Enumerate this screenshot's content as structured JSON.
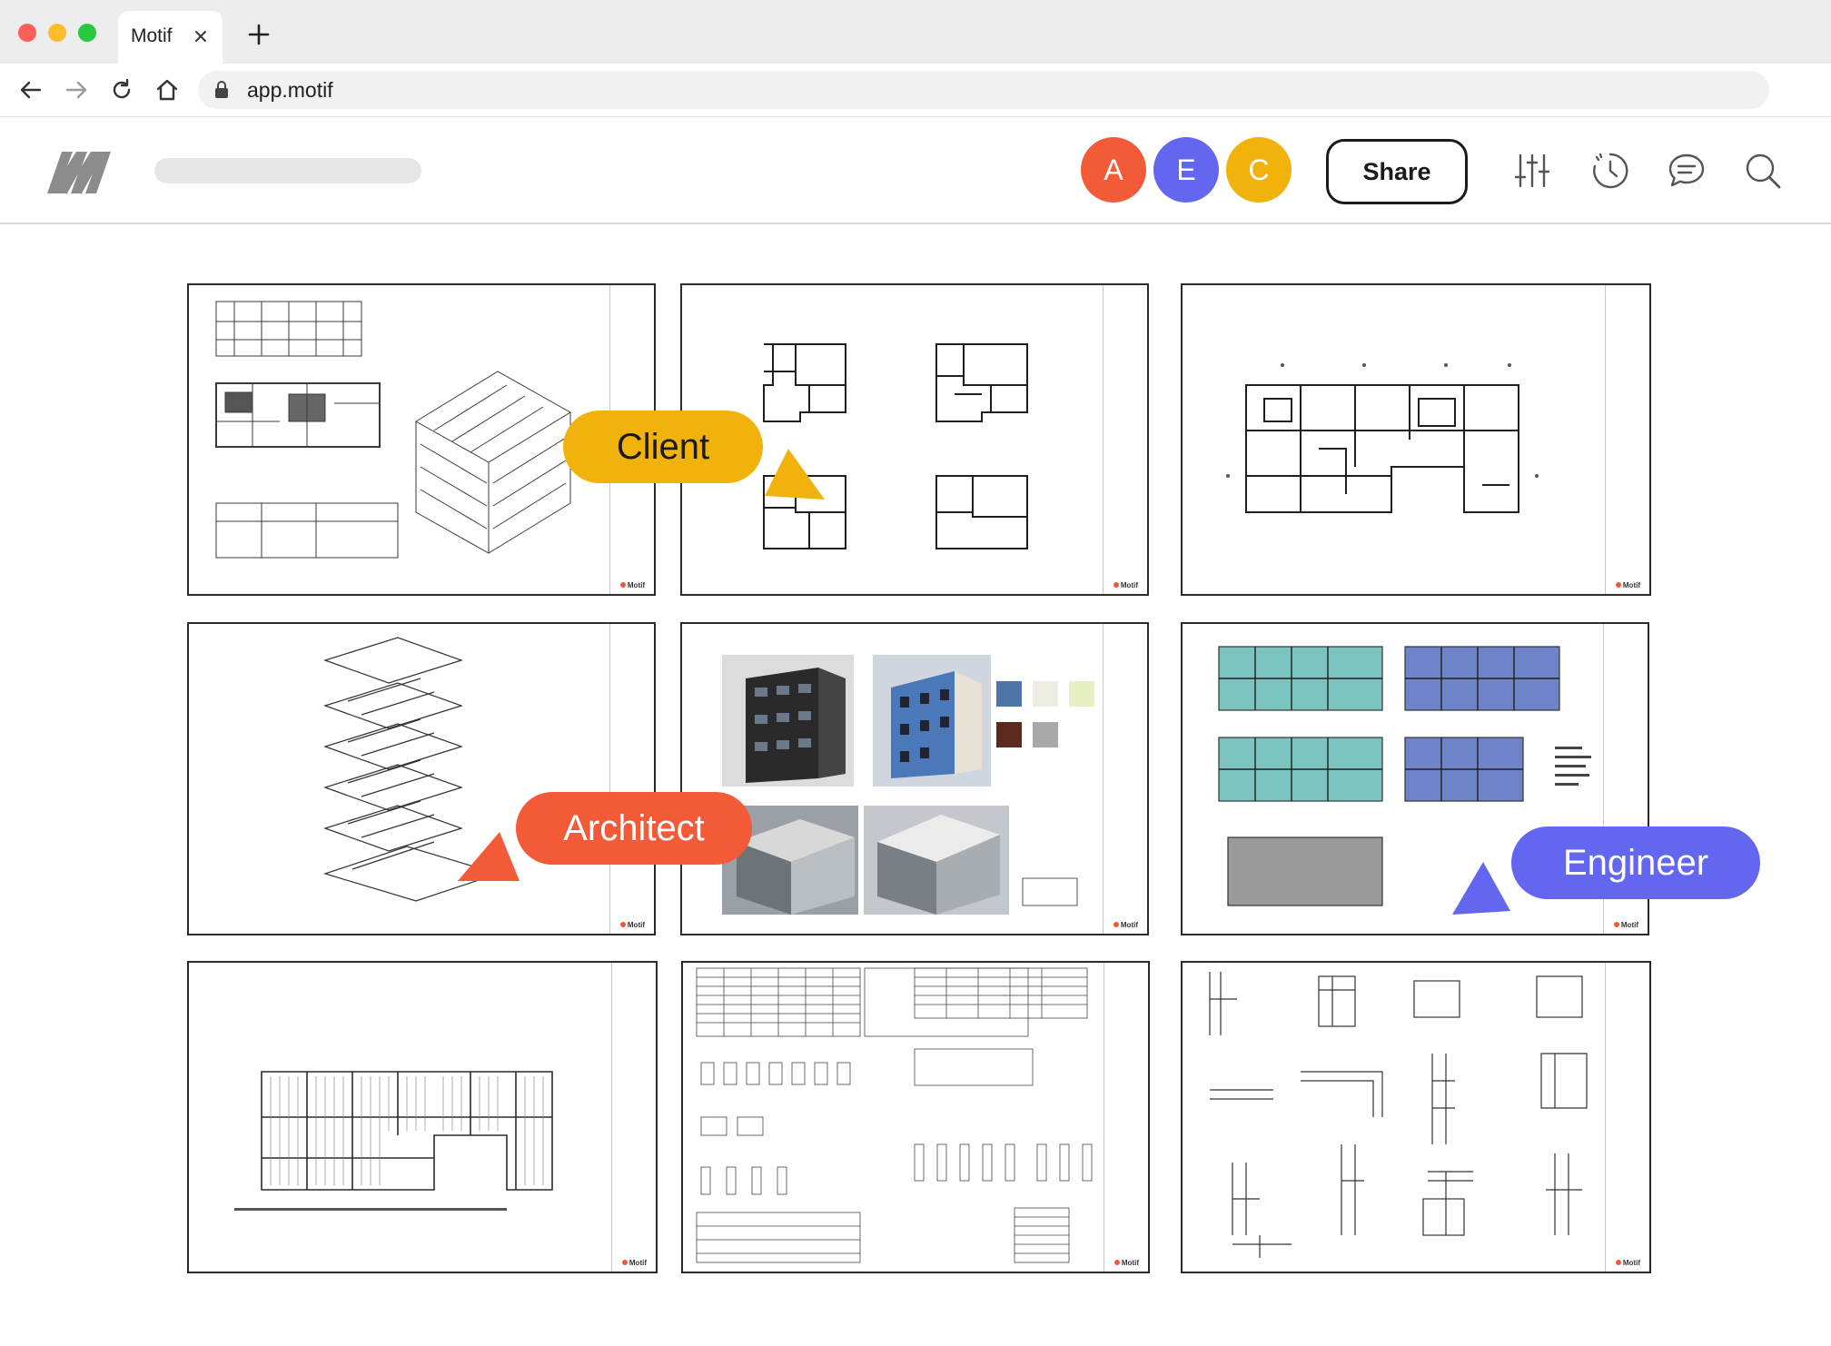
{
  "browser": {
    "tab_title": "Motif",
    "url": "app.motif"
  },
  "header": {
    "collaborators": [
      {
        "initial": "A",
        "color": "#f35a38"
      },
      {
        "initial": "E",
        "color": "#6366ee"
      },
      {
        "initial": "C",
        "color": "#f2b20c"
      }
    ],
    "share_label": "Share",
    "icons": [
      "sliders-icon",
      "history-icon",
      "comments-icon",
      "search-icon"
    ]
  },
  "sheets": [
    {
      "name": "sheet-1",
      "brand": "Motif"
    },
    {
      "name": "sheet-2",
      "brand": "Motif"
    },
    {
      "name": "sheet-3",
      "brand": "Motif"
    },
    {
      "name": "sheet-4",
      "brand": "Motif"
    },
    {
      "name": "sheet-5",
      "brand": "Motif"
    },
    {
      "name": "sheet-6",
      "brand": "Motif"
    },
    {
      "name": "sheet-7",
      "brand": "Motif"
    },
    {
      "name": "sheet-8",
      "brand": "Motif"
    },
    {
      "name": "sheet-9",
      "brand": "Motif"
    }
  ],
  "cursors": {
    "client": {
      "label": "Client",
      "color": "#f2b20c"
    },
    "architect": {
      "label": "Architect",
      "color": "#f35a38"
    },
    "engineer": {
      "label": "Engineer",
      "color": "#6366ee"
    }
  }
}
